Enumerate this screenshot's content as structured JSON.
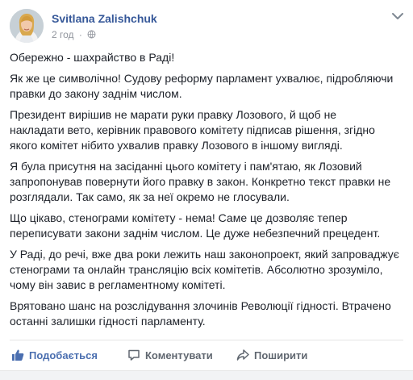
{
  "post": {
    "author": "Svitlana Zalishchuk",
    "time": "2 год",
    "separator": "·",
    "paragraphs": [
      [
        "Обережно - шахрайство в Раді!"
      ],
      [
        "Як же це символічно! Судову реформу парламент ухвалює, підробляючи",
        "правки до закону заднім числом."
      ],
      [
        "Президент вирішив не марати руки правку Лозового, й щоб не",
        "накладати вето, керівник правового комітету підписав рішення, згідно",
        "якого комітет нібито ухвалив правку Лозового в іншому вигляді."
      ],
      [
        "Я була присутня на засіданні цього комітету і пам'ятаю, як Лозовий",
        "запропонував повернути його правку в закон. Конкретно текст правки не",
        "розглядали. Так само, як за неї окремо не глосували."
      ],
      [
        "Що цікаво, стенограми комітету - нема! Саме це дозволяє тепер",
        "переписувати закони заднім числом. Це дуже небезпечний прецедент."
      ],
      [
        "У Раді, до речі, вже два роки лежить наш законопроект, який запроваджує",
        "стенограми та онлайн трансляцію всіх комітетів. Абсолютно зрозуміло,",
        "чому він завис в регламентному комітеті."
      ],
      [
        "Врятовано шанс на розслідування злочинів Революції гідності. Втрачено",
        "останні залишки гідності парламенту."
      ]
    ]
  },
  "actions": {
    "like": "Подобається",
    "comment": "Коментувати",
    "share": "Поширити"
  },
  "icons": {
    "avatar": "avatar",
    "privacy": "globe-icon",
    "menu": "chevron-down-icon",
    "like": "thumbs-up-icon",
    "comment": "comment-icon",
    "share": "share-icon"
  },
  "colors": {
    "author": "#365899",
    "meta": "#90949c",
    "text": "#1d2129",
    "like_action": "#4b6fb0",
    "action": "#606770"
  }
}
